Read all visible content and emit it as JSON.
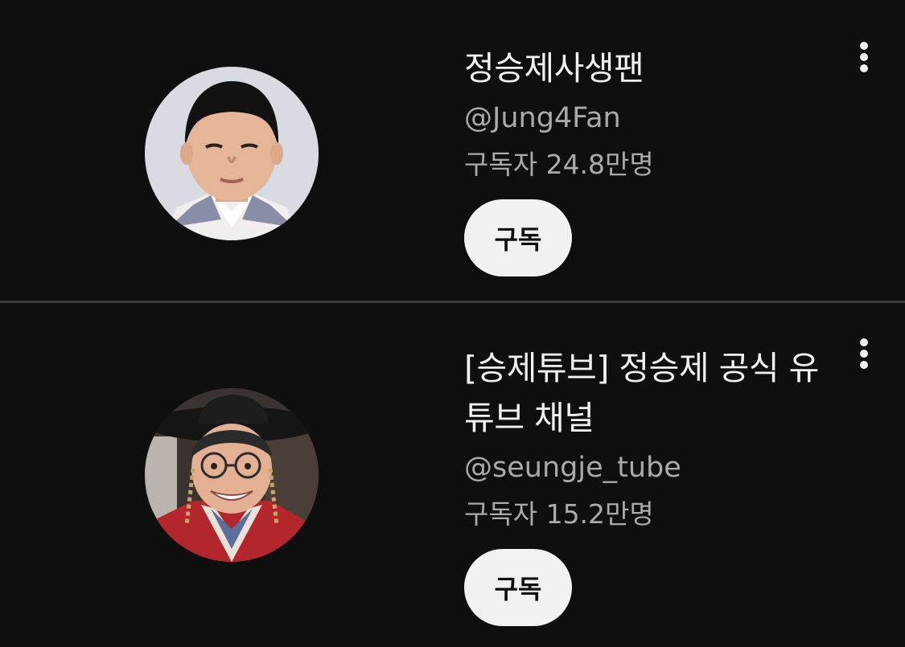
{
  "channels": [
    {
      "title": "정승제사생팬",
      "handle": "@Jung4Fan",
      "subscribers": "구독자 24.8만명",
      "subscribe_label": "구독",
      "avatar_icon": "boy-portrait-avatar",
      "more_icon": "more-vert-icon"
    },
    {
      "title": "[승제튜브] 정승제 공식 유튜브 채널",
      "handle": "@seungje_tube",
      "subscribers": "구독자 15.2만명",
      "subscribe_label": "구독",
      "avatar_icon": "man-in-traditional-hat-avatar",
      "more_icon": "more-vert-icon"
    }
  ],
  "colors": {
    "background": "#0f0f0f",
    "primary_text": "#f1f1f1",
    "secondary_text": "#aaaaaa",
    "button_bg": "#f1f1f1",
    "button_text": "#0f0f0f",
    "divider": "#3a3a3a"
  }
}
